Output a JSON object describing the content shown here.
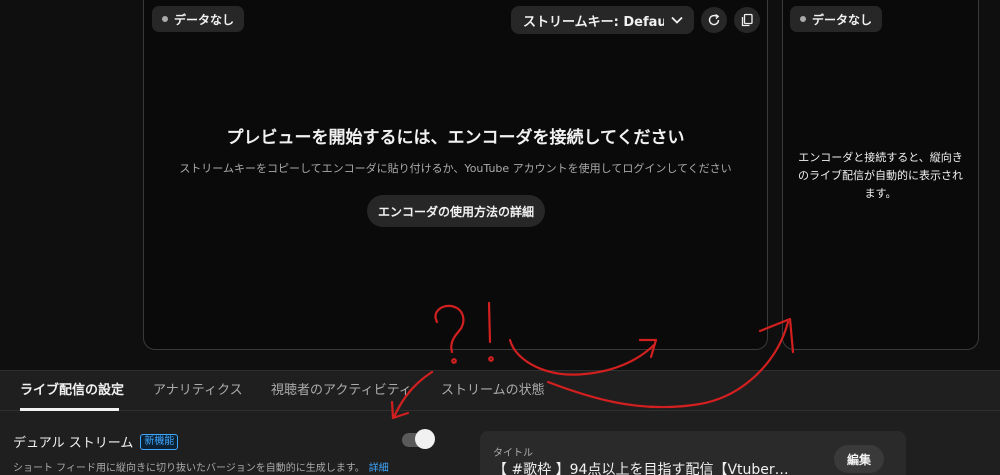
{
  "preview": {
    "nodata_label": "データなし",
    "stream_key_label": "ストリームキー: Default stre",
    "heading": "プレビューを開始するには、エンコーダを接続してください",
    "subtext": "ストリームキーをコピーしてエンコーダに貼り付けるか、YouTube アカウントを使用してログインしてください",
    "learn_button": "エンコーダの使用方法の詳細",
    "icons": [
      "refresh-icon",
      "copy-icon",
      "chevron-down-icon"
    ]
  },
  "vertical": {
    "nodata_label": "データなし",
    "message": "エンコーダと接続すると、縦向きのライブ配信が自動的に表示されます。"
  },
  "tabs": [
    {
      "label": "ライブ配信の設定",
      "active": true
    },
    {
      "label": "アナリティクス",
      "active": false
    },
    {
      "label": "視聴者のアクティビティ",
      "active": false
    },
    {
      "label": "ストリームの状態",
      "active": false
    }
  ],
  "dual_stream": {
    "label": "デュアル ストリーム",
    "badge": "新機能",
    "description": "ショート フィード用に縦向きに切り抜いたバージョンを自動的に生成します。",
    "link": "詳細",
    "enabled": true
  },
  "title_card": {
    "label": "タイトル",
    "value": "【 #歌枠 】94点以上を目指す配信【Vtuber…",
    "edit_button": "編集"
  },
  "annotation": {
    "text": "?!",
    "color": "#d21f1f"
  }
}
